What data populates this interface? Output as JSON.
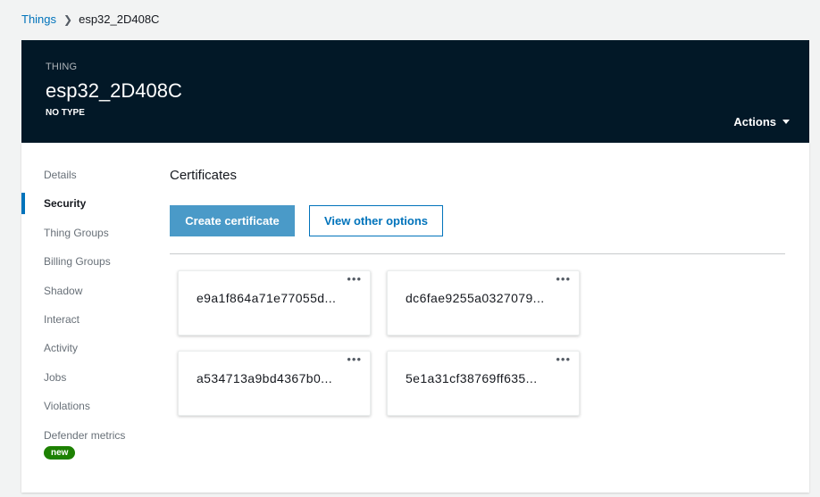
{
  "breadcrumb": {
    "parent": "Things",
    "current": "esp32_2D408C"
  },
  "header": {
    "eyebrow": "THING",
    "title": "esp32_2D408C",
    "type": "NO TYPE",
    "actions_label": "Actions"
  },
  "sidebar": {
    "items": [
      {
        "label": "Details"
      },
      {
        "label": "Security",
        "active": true
      },
      {
        "label": "Thing Groups"
      },
      {
        "label": "Billing Groups"
      },
      {
        "label": "Shadow"
      },
      {
        "label": "Interact"
      },
      {
        "label": "Activity"
      },
      {
        "label": "Jobs"
      },
      {
        "label": "Violations"
      },
      {
        "label": "Defender metrics"
      }
    ],
    "new_badge": "new"
  },
  "main": {
    "section_title": "Certificates",
    "create_button": "Create certificate",
    "other_options_button": "View other options",
    "more_glyph": "•••",
    "certificates": [
      {
        "id": "e9a1f864a71e77055d..."
      },
      {
        "id": "dc6fae9255a0327079..."
      },
      {
        "id": "a534713a9bd4367b0..."
      },
      {
        "id": "5e1a31cf38769ff635..."
      }
    ]
  },
  "colors": {
    "header_bg": "#021827",
    "link": "#0073bb",
    "primary_button": "#4a9ac8",
    "badge_green": "#1d8102"
  }
}
